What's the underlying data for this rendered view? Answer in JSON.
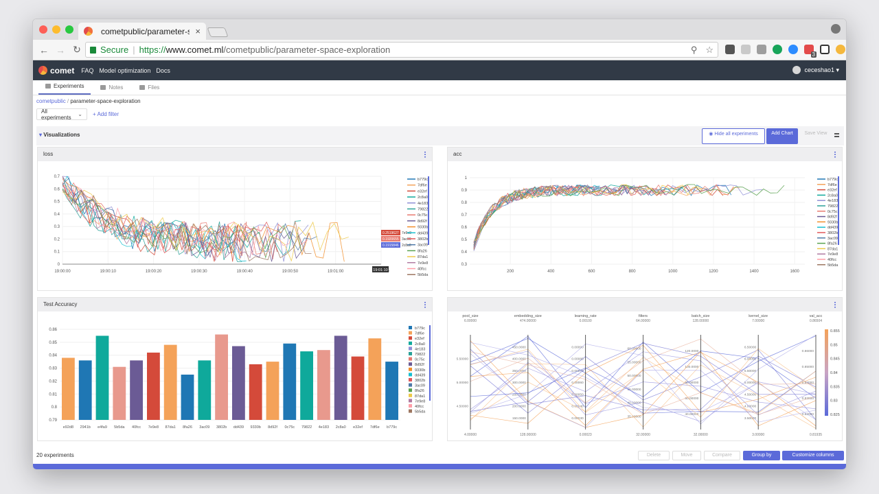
{
  "browser": {
    "tab_title": "cometpublic/parameter-space",
    "tab_close": "×",
    "secure_label": "Secure",
    "url_scheme": "https://",
    "url_host": "www.comet.ml",
    "url_path": "/cometpublic/parameter-space-exploration",
    "ext_badge": "3",
    "colors": {
      "secure": "#1a8a3a",
      "close": "#fd5f57",
      "minimize": "#fdbc2e",
      "maximize": "#28c840"
    }
  },
  "app": {
    "brand": "comet",
    "nav": [
      "FAQ",
      "Model optimization",
      "Docs"
    ],
    "user": "ceceshao1 ▾",
    "tabs": [
      "Experiments",
      "Notes",
      "Files"
    ],
    "breadcrumb": {
      "workspace": "cometpublic",
      "sep": " / ",
      "project": "parameter-space-exploration"
    },
    "filter_select": "All experiments",
    "add_filter": "+ Add filter",
    "viz_title": "Visualizations",
    "buttons": {
      "hide_all": "Hide all experiments",
      "add_chart": "Add Chart",
      "save_view": "Save View"
    },
    "accent": "#5b6ad9"
  },
  "footer": {
    "count": "20 experiments",
    "delete": "Delete",
    "move": "Move",
    "compare": "Compare",
    "group_by": "Group by",
    "customize": "Customize columns"
  },
  "series_names": [
    "b779c",
    "7df6e",
    "e32ef",
    "2c8a0",
    "4e183",
    "79822",
    "0c75c",
    "8d92f",
    "9330b",
    "dd439",
    "3802b",
    "3ac09",
    "8fa26",
    "87da1",
    "7e9e8",
    "40fcc",
    "5b5da"
  ],
  "series_colors": [
    "#1f77b4",
    "#f4a259",
    "#d44a3a",
    "#0fa99b",
    "#8f8fd6",
    "#2aa198",
    "#e8796f",
    "#6b5b95",
    "#f28e2b",
    "#17becf",
    "#e15759",
    "#4e79a7",
    "#59a14f",
    "#edc948",
    "#b07aa1",
    "#ff9da7",
    "#9c755f"
  ],
  "chart_data": [
    {
      "type": "line",
      "title": "loss",
      "ylim": [
        0,
        0.7
      ],
      "yticks": [
        "0",
        "0.1",
        "0.2",
        "0.3",
        "0.4",
        "0.5",
        "0.6",
        "0.7"
      ],
      "xticks": [
        "19:00:00",
        "19:00:10",
        "19:00:20",
        "19:00:30",
        "19:00:40",
        "19:00:50",
        "19:01:00",
        "19:01:10"
      ],
      "hover_labels": [
        {
          "value": "0.2519627",
          "name": "7e9e8",
          "color": "#d44a3a"
        },
        {
          "value": "0.1920655",
          "name": "3ac09",
          "color": "#e8796f"
        },
        {
          "value": "0.1915846",
          "name": "2c8a0",
          "color": "#5b6ad9"
        }
      ],
      "hover_x": "19:01:10",
      "grid": true,
      "legend": "right"
    },
    {
      "type": "line",
      "title": "acc",
      "ylim": [
        0.3,
        1.0
      ],
      "yticks": [
        "0.3",
        "0.4",
        "0.5",
        "0.6",
        "0.7",
        "0.8",
        "0.9",
        "1"
      ],
      "xticks": [
        "200",
        "400",
        "600",
        "800",
        "1000",
        "1200",
        "1400",
        "1600"
      ],
      "xlim": [
        0,
        1650
      ],
      "grid": true,
      "legend": "right"
    },
    {
      "type": "bar",
      "title": "Test Accuracy",
      "categories": [
        "e92d8",
        "2941b",
        "e4fa9",
        "5b5da",
        "40fcc",
        "7e9e8",
        "87da1",
        "8fa26",
        "3ac09",
        "3802b",
        "dd439",
        "9330b",
        "8d92f",
        "0c75c",
        "79822",
        "4e183",
        "2c8a0",
        "e32ef",
        "7df6e",
        "b779c"
      ],
      "values": [
        0.838,
        0.836,
        0.855,
        0.831,
        0.836,
        0.842,
        0.848,
        0.825,
        0.836,
        0.856,
        0.847,
        0.833,
        0.835,
        0.849,
        0.843,
        0.844,
        0.855,
        0.839,
        0.853,
        0.835
      ],
      "colors": [
        "#f4a259",
        "#1f77b4",
        "#0fa99b",
        "#e8998d",
        "#6b5b95",
        "#d44a3a",
        "#f4a259",
        "#1f77b4",
        "#0fa99b",
        "#e8998d",
        "#6b5b95",
        "#d44a3a",
        "#f4a259",
        "#1f77b4",
        "#0fa99b",
        "#e8998d",
        "#6b5b95",
        "#d44a3a",
        "#f4a259",
        "#1f77b4"
      ],
      "ylim": [
        0.79,
        0.86
      ],
      "yticks": [
        "0.79",
        "0.8",
        "0.81",
        "0.82",
        "0.83",
        "0.84",
        "0.85",
        "0.86"
      ],
      "legend": "right"
    },
    {
      "type": "parallel",
      "axes": [
        {
          "label": "pool_size",
          "top": "6.00000",
          "bottom": "4.00000",
          "ticks": [
            "5.50000",
            "5.00000",
            "4.50000"
          ]
        },
        {
          "label": "embedding_size",
          "top": "474.00000",
          "bottom": "128.00000",
          "ticks": [
            "450.0000",
            "400.0000",
            "350.0000",
            "300.0000",
            "250.0000",
            "200.0000",
            "150.0000"
          ]
        },
        {
          "label": "learning_rate",
          "top": "0.00100",
          "bottom": "0.00023",
          "ticks": [
            "0.00090",
            "0.00080",
            "0.00070",
            "0.00060",
            "0.00050",
            "0.00040",
            "0.00030"
          ]
        },
        {
          "label": "filters",
          "top": "64.00000",
          "bottom": "32.00000",
          "ticks": [
            "60.00000",
            "55.00000",
            "50.00000",
            "45.00000",
            "40.00000",
            "35.00000"
          ]
        },
        {
          "label": "batch_size",
          "top": "128.00000",
          "bottom": "32.00000",
          "ticks": [
            "120.0000",
            "100.0000",
            "80.00000",
            "60.00000",
            "40.00000"
          ]
        },
        {
          "label": "kernel_size",
          "top": "7.00000",
          "bottom": "3.00000",
          "ticks": [
            "6.50000",
            "6.00000",
            "5.50000",
            "5.00000",
            "4.50000",
            "4.00000",
            "3.50000"
          ]
        },
        {
          "label": "val_acc",
          "top": "0.86504",
          "bottom": "0.81935",
          "ticks": [
            "0.86000",
            "0.85000",
            "0.84000",
            "0.83000",
            "0.82000"
          ]
        }
      ],
      "colorbar": {
        "ticks": [
          "0.855",
          "0.85",
          "0.845",
          "0.84",
          "0.835",
          "0.83",
          "0.825"
        ]
      }
    }
  ]
}
